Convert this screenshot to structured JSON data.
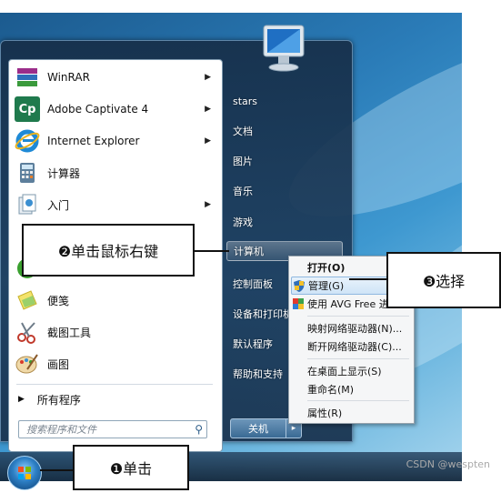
{
  "start_menu": {
    "programs": [
      {
        "label": "WinRAR",
        "icon": "winrar-icon",
        "has_submenu": true
      },
      {
        "label": "Adobe Captivate 4",
        "icon": "captivate-icon",
        "has_submenu": true
      },
      {
        "label": "Internet Explorer",
        "icon": "internet-explorer-icon",
        "has_submenu": true
      },
      {
        "label": "计算器",
        "icon": "calculator-icon",
        "has_submenu": false
      },
      {
        "label": "入门",
        "icon": "getting-started-icon",
        "has_submenu": true
      },
      {
        "label": "便笺",
        "icon": "sticky-notes-icon",
        "has_submenu": false
      },
      {
        "label": "截图工具",
        "icon": "snipping-tool-icon",
        "has_submenu": false
      },
      {
        "label": "画图",
        "icon": "paint-icon",
        "has_submenu": false
      }
    ],
    "all_programs": "所有程序",
    "search_placeholder": "搜索程序和文件",
    "right_items": [
      "stars",
      "文档",
      "图片",
      "音乐",
      "游戏",
      "计算机",
      "控制面板",
      "设备和打印机",
      "默认程序",
      "帮助和支持"
    ],
    "shutdown": "关机",
    "icon_glyphs": {
      "cp": "Cp",
      "search": "⚲",
      "arrow": "▶",
      "submenu": "▸"
    }
  },
  "context_menu": {
    "items": [
      {
        "label": "打开(O)",
        "bold": true
      },
      {
        "label": "管理(G)",
        "highlighted": true
      },
      {
        "label": "使用 AVG Free 进"
      },
      {
        "label": "映射网络驱动器(N)..."
      },
      {
        "label": "断开网络驱动器(C)..."
      },
      {
        "label": "在桌面上显示(S)"
      },
      {
        "label": "重命名(M)"
      },
      {
        "label": "属性(R)"
      }
    ]
  },
  "callouts": {
    "step1": "❶单击",
    "step2": "❷单击鼠标右键",
    "step3": "❸选择"
  },
  "watermark": "CSDN @wespten",
  "colors": {
    "highlight": "#cfe4f7",
    "menu_bg": "#1e3e5e"
  }
}
